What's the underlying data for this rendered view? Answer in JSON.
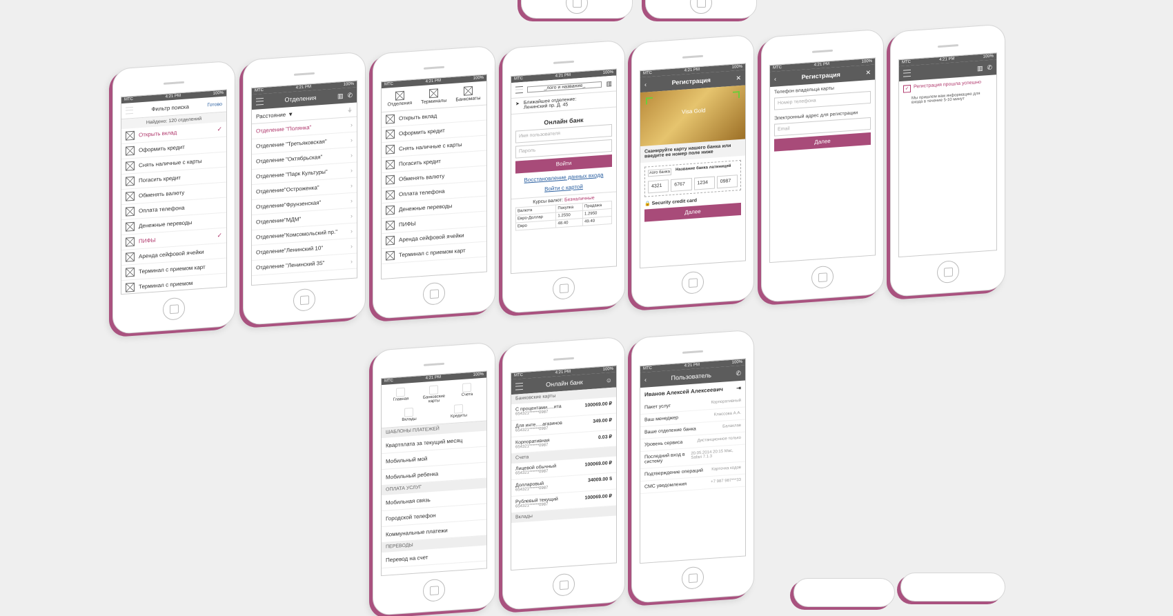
{
  "status": {
    "carrier": "МТС",
    "time": "4:21 PM",
    "battery": "100%"
  },
  "filter": {
    "title": "Фильтр поиска",
    "done": "Готово",
    "found": "Найдено: 120 отделений",
    "items": [
      "Открыть вклад",
      "Оформить кредит",
      "Снять наличные с карты",
      "Погасить кредит",
      "Обменять валюту",
      "Оплата телефона",
      "Денежные переводы",
      "ПИФЫ",
      "Аренда сейфовой ячейки",
      "Терминал с приемом карт",
      "Терминал с приемом"
    ]
  },
  "branches": {
    "title": "Отделения",
    "sort": "Расстояние",
    "items": [
      "Отделение \"Полянка\"",
      "Отделение \"Третьяковская\"",
      "Отделение \"Октябрьская\"",
      "Отделение \"Парк Культуры\"",
      "Отделение\"Остроженка\"",
      "Отделение\"Фрунзенская\"",
      "Отделение\"МДМ\"",
      "Отделение\"Комсомольский пр.\"",
      "Отделение\"Ленинский 10\"",
      "Отделение \"Ленинский 35\""
    ]
  },
  "services": {
    "tabs": [
      "Отделения",
      "Терминалы",
      "Банкоматы"
    ],
    "items": [
      "Открыть вклад",
      "Оформить кредит",
      "Снять наличные с карты",
      "Погасить кредит",
      "Обменять валюту",
      "Оплата телефона",
      "Денежные переводы",
      "ПИФЫ",
      "Аренда сейфовой ячейки",
      "Терминал с приемом карт"
    ]
  },
  "login": {
    "logo": "_лого и название_",
    "nearest": "Ближайшее отделение:",
    "address": "Ленинский пр. Д. 45",
    "title": "Онлайн банк",
    "user_placeholder": "Имя пользователя",
    "pass_placeholder": "Пароль",
    "login_btn": "Войти",
    "restore": "Восстановление данных входа",
    "card_login": "Войти с картой",
    "rates_label": "Курсы валют:",
    "rates_type": "Безналичные",
    "rates_head": [
      "Валюта",
      "Покупка",
      "Продажа"
    ],
    "rates": [
      [
        "Евро-Доллар",
        "1.2550",
        "1.2950"
      ],
      [
        "Евро",
        "48.40",
        "49.40"
      ]
    ]
  },
  "scan": {
    "title": "Регистрация",
    "card_text": "Visa Gold",
    "instruction": "Сканируйте карту нашего банка или введите ее номер поле ниже",
    "bank_logo": "лого банка",
    "bank_name": "Название банка латиницей",
    "digits": [
      "4321",
      "6767",
      "1234",
      "0987"
    ],
    "security": "Security credit card",
    "next": "Далее"
  },
  "register": {
    "title": "Регистрация",
    "phone_label": "Телефон владельца карты",
    "phone_placeholder": "Номер телефона",
    "email_label": "Электронный адрес для регистрации",
    "email_placeholder": "Email",
    "next": "Далее"
  },
  "success": {
    "title": "Регистрация прошла успешно",
    "text": "Мы пришлем вам информацию для входа в течение 5-10 минут"
  },
  "payments": {
    "icons": [
      "Главная",
      "Банковские карты",
      "Счета",
      "Вклады",
      "Кредиты"
    ],
    "sections": [
      {
        "name": "ШАБЛОНЫ ПЛАТЕЖЕЙ",
        "items": [
          "Квартплата за текущий месяц",
          "Мобильный мой",
          "Мобильный ребенка"
        ]
      },
      {
        "name": "ОПЛАТА УСЛУГ",
        "items": [
          "Мобильная связь",
          "Городской телефон",
          "Коммунальные платежи"
        ]
      },
      {
        "name": "ПЕРЕВОДЫ",
        "items": [
          "Перевод на счет"
        ]
      }
    ]
  },
  "online": {
    "title": "Онлайн банк",
    "cards_section": "Банковские карты",
    "cards": [
      [
        "С процентами.....ита",
        "654321******0987",
        "100069.00 ₽"
      ],
      [
        "Для инте.....агазинов",
        "654321******0987",
        "349.00 ₽"
      ],
      [
        "Корпоративная",
        "654321******0987",
        "0.03 ₽"
      ]
    ],
    "accounts_section": "Счета",
    "accounts": [
      [
        "Лицевой обычный",
        "654321******0987",
        "100069.00 ₽"
      ],
      [
        "Долларовый",
        "654321******0987",
        "34009.00 $"
      ],
      [
        "Рублевый текущий",
        "654321******0987",
        "100069.00 ₽"
      ]
    ],
    "deposits_section": "Вклады"
  },
  "profile": {
    "title": "Пользователь",
    "name": "Иванов Алексей Алексеевич",
    "rows": [
      [
        "Пакет услуг",
        "Корпоративный"
      ],
      [
        "Ваш менеджер",
        "Классова А.А."
      ],
      [
        "Ваше отделение банка",
        "Балаклав"
      ],
      [
        "Уровень сервиса",
        "Дистанционное только"
      ],
      [
        "Последний вход в систему",
        "20.05.2014 20:15 Mac, Safari 7.1.3"
      ],
      [
        "Подтверждение операций",
        "Карточка кодов"
      ],
      [
        "СМС уведомления",
        "+7 987 987***33"
      ]
    ]
  }
}
